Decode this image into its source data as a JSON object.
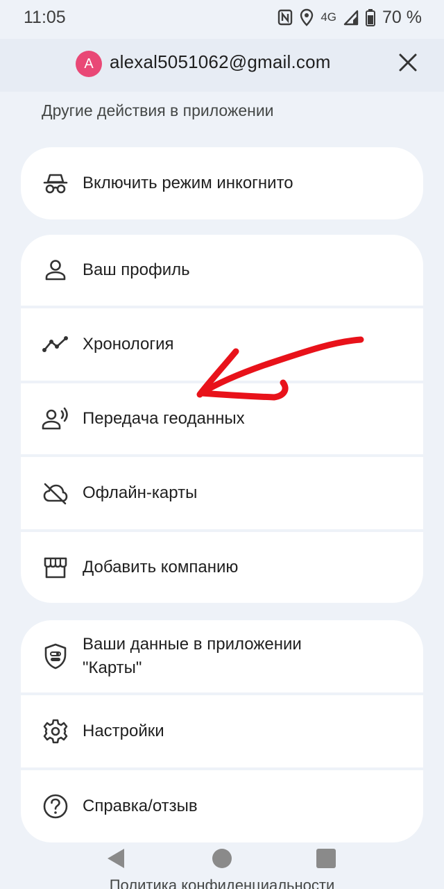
{
  "status_bar": {
    "time": "11:05",
    "network": "4G",
    "battery": "70 %"
  },
  "account": {
    "avatar_letter": "A",
    "email": "alexal5051062@gmail.com"
  },
  "section_title": "Другие действия в приложении",
  "groups": [
    {
      "items": [
        {
          "label": "Включить режим инкогнито",
          "icon": "incognito-icon"
        }
      ]
    },
    {
      "items": [
        {
          "label": "Ваш профиль",
          "icon": "person-icon"
        },
        {
          "label": "Хронология",
          "icon": "timeline-icon"
        },
        {
          "label": "Передача геоданных",
          "icon": "location-sharing-icon"
        },
        {
          "label": "Офлайн-карты",
          "icon": "offline-cloud-icon"
        },
        {
          "label": "Добавить компанию",
          "icon": "storefront-icon"
        }
      ]
    },
    {
      "items": [
        {
          "label": "Ваши данные в приложении \"Карты\"",
          "icon": "privacy-shield-icon"
        },
        {
          "label": "Настройки",
          "icon": "gear-icon"
        },
        {
          "label": "Справка/отзыв",
          "icon": "help-icon"
        }
      ]
    }
  ],
  "footer": {
    "privacy_link": "Политика конфиденциальности"
  },
  "colors": {
    "background": "#eef2f8",
    "account_bar": "#e7ecf4",
    "avatar": "#e94876",
    "annotation_arrow": "#e8121a"
  }
}
